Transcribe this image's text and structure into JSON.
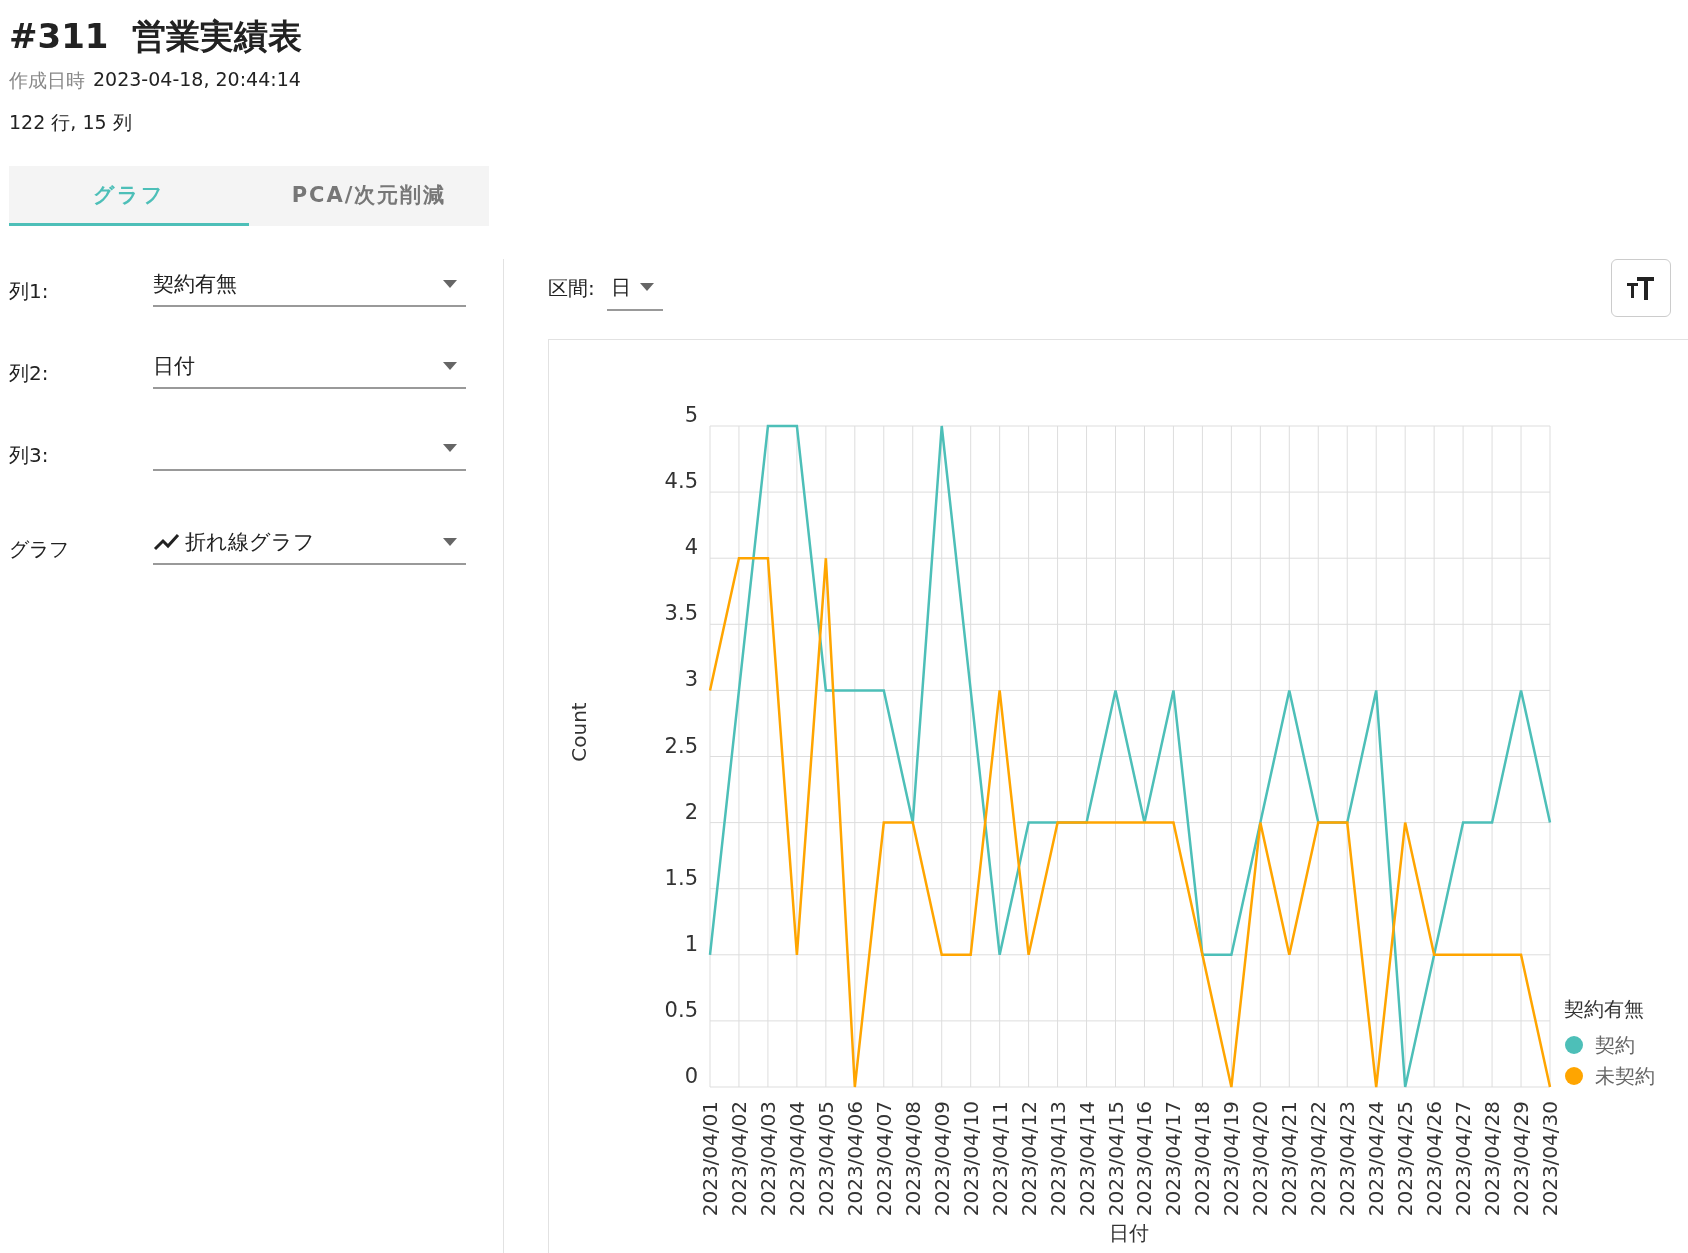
{
  "header": {
    "title": "#311  営業実績表",
    "created_label": "作成日時",
    "created_value": "2023-04-18, 20:44:14",
    "size": "122 行, 15 列"
  },
  "tabs": [
    {
      "label": "グラフ",
      "selected": true
    },
    {
      "label": "PCA/次元削減",
      "selected": false
    }
  ],
  "settings": [
    {
      "label": "列1:",
      "value": "契約有無",
      "kind": "plain"
    },
    {
      "label": "列2:",
      "value": "日付",
      "kind": "plain"
    },
    {
      "label": "列3:",
      "kind": "plain"
    },
    {
      "label": "グラフ",
      "value": "折れ線グラフ",
      "kind": "line-chart"
    }
  ],
  "interval": {
    "label": "区間:",
    "value": "日"
  },
  "chart_data": {
    "type": "line",
    "ylabel": "Count",
    "xlabel": "日付",
    "ylim": [
      0,
      5
    ],
    "yticks": [
      0,
      0.5,
      1,
      1.5,
      2,
      2.5,
      3,
      3.5,
      4,
      4.5,
      5
    ],
    "categories": [
      "2023/04/01",
      "2023/04/02",
      "2023/04/03",
      "2023/04/04",
      "2023/04/05",
      "2023/04/06",
      "2023/04/07",
      "2023/04/08",
      "2023/04/09",
      "2023/04/10",
      "2023/04/11",
      "2023/04/12",
      "2023/04/13",
      "2023/04/14",
      "2023/04/15",
      "2023/04/16",
      "2023/04/17",
      "2023/04/18",
      "2023/04/19",
      "2023/04/20",
      "2023/04/21",
      "2023/04/22",
      "2023/04/23",
      "2023/04/24",
      "2023/04/25",
      "2023/04/26",
      "2023/04/27",
      "2023/04/28",
      "2023/04/29",
      "2023/04/30"
    ],
    "grid": true,
    "legend": {
      "title": "契約有無"
    },
    "series": [
      {
        "name": "契約",
        "color": "#4dbfb8",
        "values": [
          1,
          3,
          5,
          5,
          3,
          3,
          3,
          2,
          5,
          3,
          1,
          2,
          2,
          2,
          3,
          2,
          3,
          1,
          1,
          2,
          3,
          2,
          2,
          3,
          0,
          1,
          2,
          2,
          3,
          2
        ]
      },
      {
        "name": "未契約",
        "color": "#ffa500",
        "values": [
          3,
          4,
          4,
          1,
          4,
          0,
          2,
          2,
          1,
          1,
          3,
          1,
          2,
          2,
          2,
          2,
          2,
          1,
          0,
          2,
          1,
          2,
          2,
          0,
          2,
          1,
          1,
          1,
          1,
          0
        ]
      }
    ]
  }
}
